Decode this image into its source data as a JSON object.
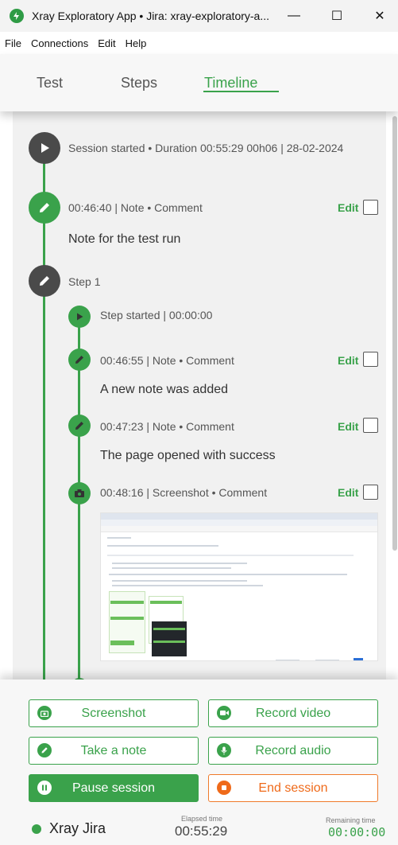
{
  "window": {
    "title": "Xray Exploratory App • Jira: xray-exploratory-a...",
    "minimize": "—",
    "maximize": "☐",
    "close": "✕"
  },
  "menu": [
    "File",
    "Connections",
    "Edit",
    "Help"
  ],
  "tabs": {
    "test": "Test",
    "steps": "Steps",
    "timeline": "Timeline",
    "active": "Timeline"
  },
  "timeline": {
    "session": "Session started • Duration 00:55:29 00h06 | 28-02-2024",
    "note1": {
      "header": "00:46:40 | Note • Comment",
      "body": "Note for the test run",
      "edit": "Edit"
    },
    "step": {
      "label": "Step 1"
    },
    "step_started": "Step started | 00:00:00",
    "note2": {
      "header": "00:46:55 | Note • Comment",
      "body": "A new note was added",
      "edit": "Edit"
    },
    "note3": {
      "header": "00:47:23 | Note • Comment",
      "body": "The page opened with success",
      "edit": "Edit"
    },
    "screenshot": {
      "header": "00:48:16 | Screenshot • Comment",
      "edit": "Edit"
    }
  },
  "actions": {
    "screenshot": "Screenshot",
    "record_video": "Record video",
    "take_note": "Take a note",
    "record_audio": "Record audio",
    "pause": "Pause session",
    "end": "End session"
  },
  "footer": {
    "app_name": "Xray Jira",
    "elapsed_label": "Elapsed time",
    "elapsed_value": "00:55:29",
    "remaining_label": "Remaining time",
    "remaining_value": "00:00:00"
  },
  "colors": {
    "accent": "#3aa24b",
    "dark_node": "#4a4a4a",
    "end_session": "#ef6a1a"
  },
  "icons": {
    "session": "play-icon",
    "note": "pencil-icon",
    "step": "pencil-icon",
    "step_started": "play-icon",
    "screenshot": "camera-icon"
  }
}
